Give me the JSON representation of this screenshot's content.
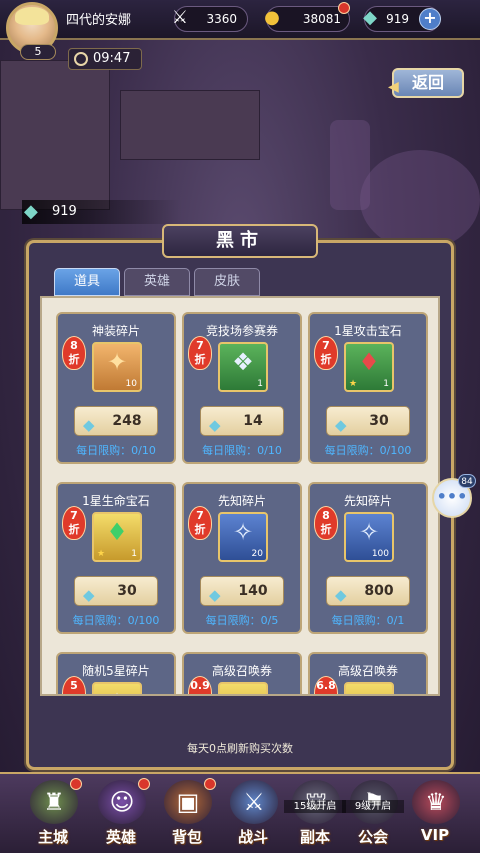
{
  "topbar": {
    "player_name": "四代的安娜",
    "level": "5",
    "power": "3360",
    "gold": "38081",
    "crystals": "919"
  },
  "timer": "09:47",
  "back_label": "返回",
  "gem_bar_value": "919",
  "panel": {
    "title": "黑市",
    "tabs": [
      "道具",
      "英雄",
      "皮肤"
    ],
    "active_tab": 0,
    "footer_note": "每天0点刷新购买次数"
  },
  "items": [
    {
      "title": "神装碎片",
      "discount": "8",
      "discount_unit": "折",
      "quantity": "10",
      "star": "",
      "price": "248",
      "limit": "每日限购：0/10",
      "color": "orange",
      "icon": "shard-icon"
    },
    {
      "title": "竞技场参赛券",
      "discount": "7",
      "discount_unit": "折",
      "quantity": "1",
      "star": "",
      "price": "14",
      "limit": "每日限购：0/10",
      "color": "green",
      "icon": "ticket-icon"
    },
    {
      "title": "1星攻击宝石",
      "discount": "7",
      "discount_unit": "折",
      "quantity": "1",
      "star": "★",
      "price": "30",
      "limit": "每日限购：0/100",
      "color": "green",
      "icon": "red-gem-icon"
    },
    {
      "title": "1星生命宝石",
      "discount": "7",
      "discount_unit": "折",
      "quantity": "1",
      "star": "★",
      "price": "30",
      "limit": "每日限购：0/100",
      "color": "yellow",
      "icon": "green-gem-icon"
    },
    {
      "title": "先知碎片",
      "discount": "7",
      "discount_unit": "折",
      "quantity": "20",
      "star": "",
      "price": "140",
      "limit": "每日限购：0/5",
      "color": "blue",
      "icon": "prophet-shard-icon"
    },
    {
      "title": "先知碎片",
      "discount": "8",
      "discount_unit": "折",
      "quantity": "100",
      "star": "",
      "price": "800",
      "limit": "每日限购：0/1",
      "color": "blue",
      "icon": "prophet-shard-icon"
    },
    {
      "title": "随机5星碎片",
      "discount": "5",
      "discount_unit": "",
      "quantity": "",
      "star": "",
      "price": "",
      "limit": "",
      "color": "yellow",
      "icon": "star-shard-icon"
    },
    {
      "title": "高级召唤券",
      "discount": "0.9",
      "discount_unit": "",
      "quantity": "",
      "star": "",
      "price": "",
      "limit": "",
      "color": "yellow",
      "icon": "summon-ticket-icon"
    },
    {
      "title": "高级召唤券",
      "discount": "6.8",
      "discount_unit": "",
      "quantity": "",
      "star": "",
      "price": "",
      "limit": "",
      "color": "yellow",
      "icon": "summon-ticket-icon"
    }
  ],
  "chat_count": "84",
  "nav": [
    {
      "label": "主城",
      "lock": "",
      "icon": "castle-icon"
    },
    {
      "label": "英雄",
      "lock": "",
      "icon": "hero-icon"
    },
    {
      "label": "背包",
      "lock": "",
      "icon": "bag-icon"
    },
    {
      "label": "战斗",
      "lock": "",
      "icon": "battle-icon"
    },
    {
      "label": "副本",
      "lock": "15级开启",
      "icon": "dungeon-icon"
    },
    {
      "label": "公会",
      "lock": "9级开启",
      "icon": "guild-icon"
    },
    {
      "label": "VIP",
      "lock": "",
      "icon": "vip-icon"
    }
  ],
  "colors": {
    "accent": "#c9a766",
    "tab_active": "#4f8bd6",
    "limit_text": "#4fb6ff",
    "discount": "#e03a2a"
  }
}
